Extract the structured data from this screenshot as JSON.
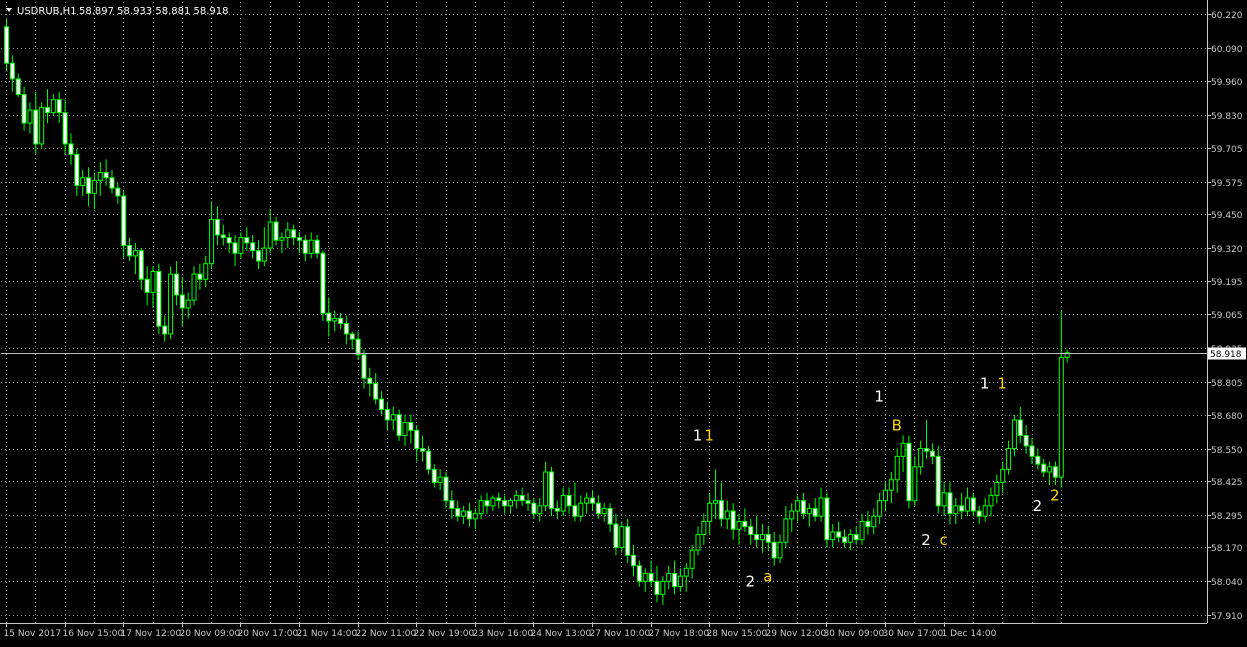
{
  "header": {
    "symbol_label": "USDRUB,H1",
    "ohlc_text": "58.897 58.933 58.881 58.918"
  },
  "colors": {
    "background": "#000000",
    "grid": "#8a8a8a",
    "axis": "#c8c8c8",
    "bull_body": "#000000",
    "bull_stroke": "#00ff00",
    "bear_body": "#ffffff",
    "bear_stroke": "#00ff00",
    "wick": "#00ff00",
    "price_line": "#c0c0c0",
    "label_white": "#ffffff",
    "label_yellow": "#ffd700"
  },
  "chart_data": {
    "type": "candlestick",
    "title": "USDRUB,H1",
    "timeframe": "H1",
    "current_price": "58.918",
    "ylim": [
      57.88,
      60.265
    ],
    "y_ticks": [
      "60.220",
      "60.090",
      "59.960",
      "59.830",
      "59.705",
      "59.575",
      "59.450",
      "59.320",
      "59.195",
      "59.065",
      "58.935",
      "58.805",
      "58.680",
      "58.550",
      "58.425",
      "58.295",
      "58.170",
      "58.040",
      "57.910"
    ],
    "x_ticks": [
      "15 Nov 2017",
      "16 Nov 15:00",
      "17 Nov 12:00",
      "20 Nov 09:00",
      "20 Nov 17:00",
      "21 Nov 14:00",
      "22 Nov 11:00",
      "22 Nov 19:00",
      "23 Nov 16:00",
      "24 Nov 13:00",
      "27 Nov 10:00",
      "27 Nov 18:00",
      "28 Nov 15:00",
      "29 Nov 12:00",
      "30 Nov 09:00",
      "30 Nov 17:00",
      "1 Dec 14:00"
    ],
    "x_tick_bar_index": [
      0,
      10,
      20,
      30,
      40,
      50,
      60,
      70,
      80,
      90,
      100,
      110,
      120,
      130,
      140,
      150,
      160
    ],
    "grid": true,
    "candles": [
      [
        60.17,
        60.2,
        60.0,
        60.03
      ],
      [
        60.03,
        60.06,
        59.92,
        59.97
      ],
      [
        59.97,
        59.99,
        59.9,
        59.91
      ],
      [
        59.91,
        59.94,
        59.77,
        59.8
      ],
      [
        59.8,
        59.88,
        59.76,
        59.85
      ],
      [
        59.85,
        59.92,
        59.68,
        59.72
      ],
      [
        59.72,
        59.88,
        59.7,
        59.86
      ],
      [
        59.86,
        59.93,
        59.8,
        59.84
      ],
      [
        59.84,
        59.91,
        59.83,
        59.89
      ],
      [
        59.89,
        59.92,
        59.8,
        59.84
      ],
      [
        59.84,
        59.89,
        59.68,
        59.72
      ],
      [
        59.72,
        59.76,
        59.64,
        59.68
      ],
      [
        59.68,
        59.7,
        59.52,
        59.56
      ],
      [
        59.56,
        59.62,
        59.52,
        59.59
      ],
      [
        59.59,
        59.63,
        59.48,
        59.53
      ],
      [
        59.53,
        59.61,
        59.47,
        59.58
      ],
      [
        59.58,
        59.65,
        59.52,
        59.61
      ],
      [
        59.61,
        59.66,
        59.56,
        59.59
      ],
      [
        59.59,
        59.62,
        59.53,
        59.55
      ],
      [
        59.55,
        59.57,
        59.49,
        59.52
      ],
      [
        59.52,
        59.54,
        59.28,
        59.33
      ],
      [
        59.33,
        59.36,
        59.27,
        59.29
      ],
      [
        59.29,
        59.34,
        59.22,
        59.31
      ],
      [
        59.31,
        59.32,
        59.16,
        59.2
      ],
      [
        59.2,
        59.25,
        59.1,
        59.15
      ],
      [
        59.15,
        59.25,
        59.09,
        59.23
      ],
      [
        59.23,
        59.26,
        58.99,
        59.02
      ],
      [
        59.02,
        59.06,
        58.96,
        58.99
      ],
      [
        58.99,
        59.25,
        58.97,
        59.22
      ],
      [
        59.22,
        59.27,
        59.1,
        59.14
      ],
      [
        59.14,
        59.21,
        59.02,
        59.09
      ],
      [
        59.09,
        59.15,
        59.05,
        59.12
      ],
      [
        59.12,
        59.25,
        59.1,
        59.22
      ],
      [
        59.22,
        59.26,
        59.16,
        59.2
      ],
      [
        59.2,
        59.29,
        59.17,
        59.26
      ],
      [
        59.26,
        59.5,
        59.24,
        59.43
      ],
      [
        59.43,
        59.48,
        59.33,
        59.37
      ],
      [
        59.37,
        59.41,
        59.33,
        59.36
      ],
      [
        59.36,
        59.38,
        59.3,
        59.34
      ],
      [
        59.34,
        59.37,
        59.25,
        59.3
      ],
      [
        59.3,
        59.38,
        59.28,
        59.36
      ],
      [
        59.36,
        59.4,
        59.31,
        59.34
      ],
      [
        59.34,
        59.37,
        59.28,
        59.31
      ],
      [
        59.31,
        59.35,
        59.24,
        59.27
      ],
      [
        59.27,
        59.4,
        59.25,
        59.32
      ],
      [
        59.32,
        59.47,
        59.3,
        59.42
      ],
      [
        59.42,
        59.44,
        59.33,
        59.35
      ],
      [
        59.35,
        59.38,
        59.3,
        59.36
      ],
      [
        59.36,
        59.42,
        59.32,
        59.39
      ],
      [
        59.39,
        59.41,
        59.33,
        59.36
      ],
      [
        59.36,
        59.38,
        59.3,
        59.35
      ],
      [
        59.35,
        59.37,
        59.27,
        59.3
      ],
      [
        59.3,
        59.38,
        59.28,
        59.35
      ],
      [
        59.35,
        59.37,
        59.28,
        59.3
      ],
      [
        59.3,
        59.31,
        59.04,
        59.07
      ],
      [
        59.07,
        59.13,
        58.98,
        59.04
      ],
      [
        59.04,
        59.08,
        59.0,
        59.05
      ],
      [
        59.05,
        59.07,
        59.01,
        59.03
      ],
      [
        59.03,
        59.06,
        58.95,
        58.99
      ],
      [
        58.99,
        59.0,
        58.93,
        58.97
      ],
      [
        58.97,
        59.0,
        58.89,
        58.91
      ],
      [
        58.91,
        58.93,
        58.78,
        58.82
      ],
      [
        58.82,
        58.86,
        58.75,
        58.8
      ],
      [
        58.8,
        58.84,
        58.72,
        58.74
      ],
      [
        58.74,
        58.77,
        58.68,
        58.7
      ],
      [
        58.7,
        58.73,
        58.62,
        58.66
      ],
      [
        58.66,
        58.71,
        58.62,
        58.68
      ],
      [
        58.68,
        58.7,
        58.58,
        58.6
      ],
      [
        58.6,
        58.68,
        58.56,
        58.65
      ],
      [
        58.65,
        58.68,
        58.57,
        58.62
      ],
      [
        58.62,
        58.64,
        58.5,
        58.55
      ],
      [
        58.55,
        58.6,
        58.5,
        58.54
      ],
      [
        58.54,
        58.56,
        58.45,
        58.47
      ],
      [
        58.47,
        58.49,
        58.4,
        58.42
      ],
      [
        58.42,
        58.47,
        58.39,
        58.44
      ],
      [
        58.44,
        58.46,
        58.32,
        58.35
      ],
      [
        58.35,
        58.39,
        58.28,
        58.32
      ],
      [
        58.32,
        58.35,
        58.27,
        58.29
      ],
      [
        58.29,
        58.33,
        58.26,
        58.31
      ],
      [
        58.31,
        58.34,
        58.25,
        58.28
      ],
      [
        58.28,
        58.32,
        58.24,
        58.3
      ],
      [
        58.3,
        58.37,
        58.28,
        58.35
      ],
      [
        58.35,
        58.38,
        58.3,
        58.33
      ],
      [
        58.33,
        58.37,
        58.31,
        58.36
      ],
      [
        58.36,
        58.38,
        58.32,
        58.35
      ],
      [
        58.35,
        58.37,
        58.3,
        58.33
      ],
      [
        58.33,
        58.36,
        58.3,
        58.35
      ],
      [
        58.35,
        58.39,
        58.32,
        58.37
      ],
      [
        58.37,
        58.4,
        58.33,
        58.35
      ],
      [
        58.35,
        58.38,
        58.31,
        58.34
      ],
      [
        58.34,
        58.36,
        58.28,
        58.3
      ],
      [
        58.3,
        58.36,
        58.27,
        58.33
      ],
      [
        58.33,
        58.5,
        58.31,
        58.46
      ],
      [
        58.46,
        58.48,
        58.29,
        58.32
      ],
      [
        58.32,
        58.35,
        58.28,
        58.31
      ],
      [
        58.31,
        58.4,
        58.29,
        58.37
      ],
      [
        58.37,
        58.4,
        58.3,
        58.33
      ],
      [
        58.33,
        58.42,
        58.27,
        58.29
      ],
      [
        58.29,
        58.37,
        58.27,
        58.34
      ],
      [
        58.34,
        58.38,
        58.3,
        58.36
      ],
      [
        58.36,
        58.39,
        58.31,
        58.34
      ],
      [
        58.34,
        58.37,
        58.28,
        58.3
      ],
      [
        58.3,
        58.34,
        58.27,
        58.32
      ],
      [
        58.32,
        58.34,
        58.23,
        58.26
      ],
      [
        58.26,
        58.3,
        58.14,
        58.17
      ],
      [
        58.17,
        58.27,
        58.15,
        58.25
      ],
      [
        58.25,
        58.28,
        58.11,
        58.14
      ],
      [
        58.14,
        58.18,
        58.06,
        58.1
      ],
      [
        58.1,
        58.12,
        58.02,
        58.04
      ],
      [
        58.04,
        58.09,
        58.0,
        58.07
      ],
      [
        58.07,
        58.12,
        58.02,
        58.04
      ],
      [
        58.04,
        58.1,
        57.96,
        57.99
      ],
      [
        57.99,
        58.06,
        57.95,
        58.04
      ],
      [
        58.04,
        58.1,
        58.01,
        58.07
      ],
      [
        58.07,
        58.12,
        57.99,
        58.02
      ],
      [
        58.02,
        58.09,
        58.0,
        58.06
      ],
      [
        58.06,
        58.11,
        58.0,
        58.09
      ],
      [
        58.09,
        58.18,
        58.05,
        58.16
      ],
      [
        58.16,
        58.25,
        58.14,
        58.22
      ],
      [
        58.22,
        58.3,
        58.18,
        58.27
      ],
      [
        58.27,
        58.38,
        58.22,
        58.34
      ],
      [
        58.34,
        58.47,
        58.28,
        58.35
      ],
      [
        58.35,
        58.42,
        58.25,
        58.28
      ],
      [
        58.28,
        58.35,
        58.24,
        58.31
      ],
      [
        58.31,
        58.34,
        58.2,
        58.24
      ],
      [
        58.24,
        58.3,
        58.18,
        58.27
      ],
      [
        58.27,
        58.32,
        58.23,
        58.25
      ],
      [
        58.25,
        58.28,
        58.18,
        58.22
      ],
      [
        58.22,
        58.29,
        58.17,
        58.2
      ],
      [
        58.2,
        58.26,
        58.15,
        58.22
      ],
      [
        58.22,
        58.25,
        58.16,
        58.19
      ],
      [
        58.19,
        58.23,
        58.1,
        58.13
      ],
      [
        58.13,
        58.22,
        58.11,
        58.19
      ],
      [
        58.19,
        58.33,
        58.17,
        58.28
      ],
      [
        58.28,
        58.34,
        58.23,
        58.31
      ],
      [
        58.31,
        58.37,
        58.27,
        58.35
      ],
      [
        58.35,
        58.38,
        58.28,
        58.3
      ],
      [
        58.3,
        58.34,
        58.25,
        58.32
      ],
      [
        58.32,
        58.36,
        58.27,
        58.29
      ],
      [
        58.29,
        58.4,
        58.27,
        58.36
      ],
      [
        58.36,
        58.38,
        58.17,
        58.2
      ],
      [
        58.2,
        58.26,
        58.17,
        58.23
      ],
      [
        58.23,
        58.27,
        58.19,
        58.21
      ],
      [
        58.21,
        58.24,
        58.17,
        58.19
      ],
      [
        58.19,
        58.24,
        58.16,
        58.22
      ],
      [
        58.22,
        58.25,
        58.18,
        58.2
      ],
      [
        58.2,
        58.3,
        58.18,
        58.27
      ],
      [
        58.27,
        58.31,
        58.22,
        58.25
      ],
      [
        58.25,
        58.32,
        58.22,
        58.29
      ],
      [
        58.29,
        58.38,
        58.26,
        58.35
      ],
      [
        58.35,
        58.42,
        58.31,
        58.39
      ],
      [
        58.39,
        58.46,
        58.34,
        58.43
      ],
      [
        58.43,
        58.55,
        58.38,
        58.52
      ],
      [
        58.52,
        58.6,
        58.46,
        58.57
      ],
      [
        58.57,
        58.6,
        58.32,
        58.35
      ],
      [
        58.35,
        58.52,
        58.33,
        58.48
      ],
      [
        58.48,
        58.58,
        58.45,
        58.55
      ],
      [
        58.55,
        58.66,
        58.51,
        58.54
      ],
      [
        58.54,
        58.57,
        58.49,
        58.52
      ],
      [
        58.52,
        58.56,
        58.3,
        58.33
      ],
      [
        58.33,
        58.42,
        58.29,
        58.38
      ],
      [
        58.38,
        58.42,
        58.26,
        58.3
      ],
      [
        58.3,
        58.36,
        58.26,
        58.33
      ],
      [
        58.33,
        58.38,
        58.28,
        58.31
      ],
      [
        58.31,
        58.4,
        58.29,
        58.36
      ],
      [
        58.36,
        58.38,
        58.29,
        58.31
      ],
      [
        58.31,
        58.33,
        58.26,
        58.29
      ],
      [
        58.29,
        58.36,
        58.27,
        58.33
      ],
      [
        58.33,
        58.4,
        58.29,
        58.37
      ],
      [
        58.37,
        58.45,
        58.34,
        58.42
      ],
      [
        58.42,
        58.5,
        58.38,
        58.47
      ],
      [
        58.47,
        58.58,
        58.45,
        58.55
      ],
      [
        58.55,
        58.68,
        58.52,
        58.66
      ],
      [
        58.66,
        58.71,
        58.57,
        58.6
      ],
      [
        58.6,
        58.64,
        58.53,
        58.56
      ],
      [
        58.56,
        58.59,
        58.49,
        58.52
      ],
      [
        58.52,
        58.55,
        58.47,
        58.49
      ],
      [
        58.49,
        58.51,
        58.44,
        58.46
      ],
      [
        58.46,
        58.5,
        58.41,
        58.48
      ],
      [
        58.48,
        58.5,
        58.41,
        58.44
      ],
      [
        58.44,
        59.08,
        58.4,
        58.9
      ],
      [
        58.9,
        58.93,
        58.88,
        58.918
      ]
    ],
    "annotations": [
      {
        "text": "1",
        "bar": 118,
        "price": 58.58,
        "color": "white"
      },
      {
        "text": "1",
        "bar": 120,
        "price": 58.58,
        "color": "yellow"
      },
      {
        "text": "2",
        "bar": 127,
        "price": 58.02,
        "color": "white"
      },
      {
        "text": "a",
        "bar": 130,
        "price": 58.04,
        "color": "yellow"
      },
      {
        "text": "1",
        "bar": 149,
        "price": 58.73,
        "color": "white"
      },
      {
        "text": "B",
        "bar": 152,
        "price": 58.62,
        "color": "yellow"
      },
      {
        "text": "2",
        "bar": 157,
        "price": 58.18,
        "color": "white"
      },
      {
        "text": "c",
        "bar": 160,
        "price": 58.18,
        "color": "yellow"
      },
      {
        "text": "1",
        "bar": 167,
        "price": 58.78,
        "color": "white"
      },
      {
        "text": "1",
        "bar": 170,
        "price": 58.78,
        "color": "yellow"
      },
      {
        "text": "2",
        "bar": 176,
        "price": 58.31,
        "color": "white"
      },
      {
        "text": "2",
        "bar": 179,
        "price": 58.35,
        "color": "yellow"
      }
    ]
  }
}
